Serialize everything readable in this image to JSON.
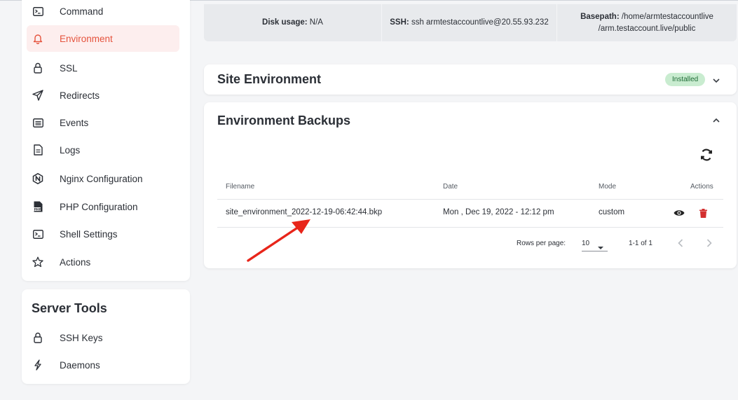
{
  "sidebar": {
    "items": [
      {
        "label": "Command",
        "icon": "terminal-icon"
      },
      {
        "label": "Environment",
        "icon": "bell-icon",
        "active": true
      },
      {
        "label": "SSL",
        "icon": "lock-icon"
      },
      {
        "label": "Redirects",
        "icon": "send-icon"
      },
      {
        "label": "Events",
        "icon": "list-icon"
      },
      {
        "label": "Logs",
        "icon": "document-icon"
      },
      {
        "label": "Nginx Configuration",
        "icon": "nginx-icon"
      },
      {
        "label": "PHP Configuration",
        "icon": "php-file-icon"
      },
      {
        "label": "Shell Settings",
        "icon": "terminal-icon"
      },
      {
        "label": "Actions",
        "icon": "star-icon"
      }
    ],
    "active_color": "#e5533d"
  },
  "server_tools": {
    "title": "Server Tools",
    "items": [
      {
        "label": "SSH Keys",
        "icon": "lock-icon"
      },
      {
        "label": "Daemons",
        "icon": "bolt-icon"
      }
    ]
  },
  "info_bar": {
    "disk_label": "Disk usage:",
    "disk_value": "N/A",
    "ssh_label": "SSH:",
    "ssh_value": "ssh armtestaccountlive@20.55.93.232",
    "basepath_label": "Basepath:",
    "basepath_line1": "/home/armtestaccountlive",
    "basepath_line2": "/arm.testaccount.live/public"
  },
  "site_environment": {
    "title": "Site Environment",
    "badge": "Installed",
    "badge_color": "#c9ecd0"
  },
  "backups": {
    "title": "Environment Backups",
    "columns": {
      "filename": "Filename",
      "date": "Date",
      "mode": "Mode",
      "actions": "Actions"
    },
    "rows": [
      {
        "filename": "site_environment_2022-12-19-06:42:44.bkp",
        "date": "Mon , Dec 19, 2022 - 12:12 pm",
        "mode": "custom"
      }
    ],
    "pagination": {
      "rows_per_page_label": "Rows per page:",
      "rows_per_page_value": "10",
      "range": "1-1 of 1"
    },
    "delete_color": "#d32f2f"
  },
  "annotation": {
    "arrow_color": "#e8251a"
  }
}
